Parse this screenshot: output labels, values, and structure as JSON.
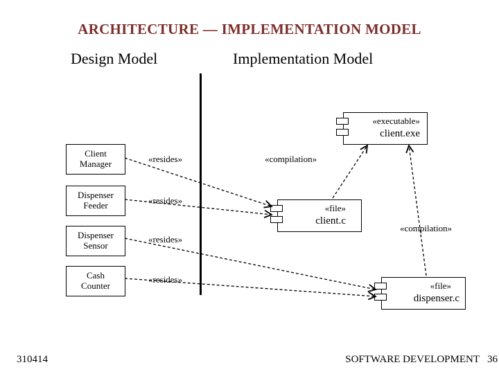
{
  "title": "ARCHITECTURE — IMPLEMENTATION MODEL",
  "subheads": {
    "design": "Design Model",
    "impl": "Implementation Model"
  },
  "classes": {
    "client_manager": "Client\nManager",
    "dispenser_feeder": "Dispenser\nFeeder",
    "dispenser_sensor": "Dispenser\nSensor",
    "cash_counter": "Cash\nCounter"
  },
  "labels": {
    "resides": "«resides»",
    "compilation": "«compilation»",
    "file": "«file»",
    "executable": "«executable»"
  },
  "components": {
    "client_exe": "client.exe",
    "client_c": "client.c",
    "dispenser_c": "dispenser.c"
  },
  "footer": {
    "left": "310414",
    "right": "SOFTWARE DEVELOPMENT",
    "page": "36"
  }
}
